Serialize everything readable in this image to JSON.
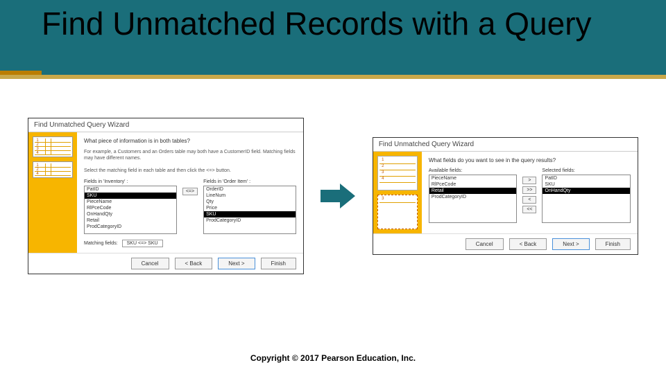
{
  "slide": {
    "title": "Find Unmatched Records with a Query"
  },
  "dialog1": {
    "title": "Find Unmatched Query Wizard",
    "question": "What piece of information is in both tables?",
    "description1": "For example, a Customers and an Orders table may both have a CustomerID field. Matching fields may have different names.",
    "description2": "Select the matching field in each table and then click the <=> button.",
    "leftLabel": "Fields in 'Inventory' :",
    "rightLabel": "Fields in 'Order Item' :",
    "leftFields": [
      "PatID",
      "SKU",
      "PieceName",
      "RlPceCode",
      "OnHandQty",
      "Retail",
      "ProdCategoryID"
    ],
    "rightFields": [
      "OrderID",
      "LineNum",
      "Qty",
      "Price",
      "SKU",
      "ProdCategoryID"
    ],
    "leftSelected": 1,
    "rightSelected": 4,
    "xferLabel": "<=>",
    "matchLabel": "Matching fields:",
    "matchValue": "SKU <=> SKU",
    "buttons": {
      "cancel": "Cancel",
      "back": "< Back",
      "next": "Next >",
      "finish": "Finish"
    }
  },
  "dialog2": {
    "title": "Find Unmatched Query Wizard",
    "question": "What fields do you want to see in the query results?",
    "availLabel": "Available fields:",
    "selLabel": "Selected fields:",
    "availFields": [
      "PieceName",
      "RlPceCode",
      "Retail",
      "ProdCategoryID"
    ],
    "selFields": [
      "PatID",
      "SKU",
      "OnHandQty"
    ],
    "availSelected": 2,
    "selSelected": 2,
    "xfer": {
      "add": ">",
      "addAll": ">>",
      "rem": "<",
      "remAll": "<<"
    },
    "buttons": {
      "cancel": "Cancel",
      "back": "< Back",
      "next": "Next >",
      "finish": "Finish"
    }
  },
  "footer": {
    "copyright": "Copyright © 2017 Pearson Education, Inc."
  }
}
